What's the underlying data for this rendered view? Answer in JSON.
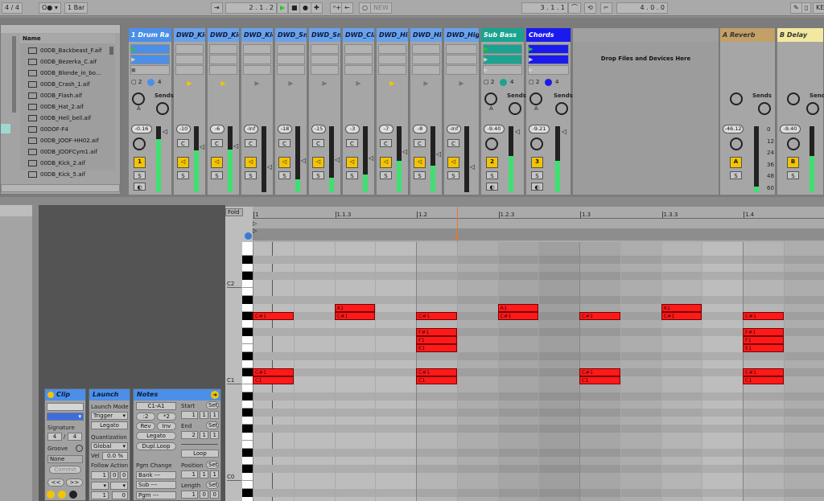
{
  "transport": {
    "signature": "4 / 4",
    "quant": "1 Bar",
    "position": "2 .  1 .  2",
    "new_label": "NEW",
    "loop_start": "3 .  1 .  1",
    "loop_length": "4 .  0 .  0",
    "key_label": "KE"
  },
  "browser": {
    "name_header": "Name",
    "files": [
      "00DB_Backbeast_F.aif",
      "00DB_Bezerka_C.aif",
      "00DB_Blonde_in_bo...",
      "00DB_Crash_1.aif",
      "00DB_Flash.aif",
      "00DB_Hat_2.aif",
      "00DB_Hell_bell.aif",
      "00DOF-F4",
      "00DB_JOOF-HH02.aif",
      "00DB_JOOFCym1.aif",
      "00DB_Kick_2.aif",
      "00DB_Kick_5.aif"
    ]
  },
  "tracks": [
    {
      "name": "1 Drum Ra",
      "color": "#4b8fe8",
      "volume": "-0.16",
      "number": "1",
      "meter": 0.8,
      "type": "group"
    },
    {
      "name": "DWD_Kic",
      "color": "#6aa2ea",
      "volume": "-10",
      "meter": 0.63,
      "type": "chain",
      "playing": true
    },
    {
      "name": "DWD_Kic",
      "color": "#6aa2ea",
      "volume": "-6",
      "meter": 0.65,
      "type": "chain",
      "playing": true
    },
    {
      "name": "DWD_Kic",
      "color": "#6aa2ea",
      "volume": "-Inf",
      "meter": 0,
      "type": "chain",
      "playing": false
    },
    {
      "name": "DWD_Sna",
      "color": "#6aa2ea",
      "volume": "-18",
      "meter": 0.2,
      "type": "chain",
      "playing": false
    },
    {
      "name": "DWD_Sna",
      "color": "#6aa2ea",
      "volume": "-15",
      "meter": 0.22,
      "type": "chain",
      "playing": false
    },
    {
      "name": "DWD_Cla",
      "color": "#6aa2ea",
      "volume": "-3",
      "meter": 0.27,
      "type": "chain",
      "playing": false
    },
    {
      "name": "DWD_Hig",
      "color": "#6aa2ea",
      "volume": "-7",
      "meter": 0.47,
      "type": "chain",
      "playing": true
    },
    {
      "name": "DWD_Hig",
      "color": "#6aa2ea",
      "volume": "-8",
      "meter": 0.4,
      "type": "chain",
      "playing": false
    },
    {
      "name": "DWD_Hig",
      "color": "#6aa2ea",
      "volume": "-Inf",
      "meter": 0,
      "type": "chain",
      "playing": false
    },
    {
      "name": "Sub Bass",
      "color": "#1aa38f",
      "volume": "-9.40",
      "number": "2",
      "meter": 0.55,
      "type": "group"
    },
    {
      "name": "Chords",
      "color": "#1a1aee",
      "volume": "-9.21",
      "number": "3",
      "meter": 0.47,
      "type": "group"
    }
  ],
  "drop_text": "Drop Files and Devices Here",
  "returns": [
    {
      "name": "A Reverb",
      "color": "#c2a068",
      "volume": "-46.12",
      "letter": "A",
      "meter": 0.08
    },
    {
      "name": "B Delay",
      "color": "#f2e8a0",
      "volume": "-9.40",
      "letter": "B",
      "meter": 0.55
    }
  ],
  "sends_label": "Sends",
  "send_a": "A",
  "send_b": "B",
  "solo": "S",
  "cue": "C",
  "meter_scale": [
    "0",
    "12",
    "24",
    "36",
    "48",
    "60"
  ],
  "clip": {
    "title": "Clip",
    "signature_label": "Signature",
    "sig_num": "4",
    "sig_den": "4",
    "groove_label": "Groove",
    "groove": "None",
    "commit": "Commit",
    "prev": "<<",
    "next": ">>"
  },
  "launch": {
    "title": "Launch",
    "mode_label": "Launch Mode",
    "mode": "Trigger",
    "legato": "Legato",
    "quant_label": "Quantization",
    "quant": "Global",
    "vel_label": "Vel",
    "vel": "0.0 %",
    "follow_label": "Follow Action",
    "f1": "1",
    "f2": "0",
    "f3": "0",
    "f4": "1",
    "f5": "0"
  },
  "notes": {
    "title": "Notes",
    "range": "C1-A1",
    "div": ":2",
    "mul": "*2",
    "rev": "Rev",
    "inv": "Inv",
    "legato": "Legato",
    "dupl": "Dupl.Loop",
    "pgm_label": "Pgm Change",
    "bank": "Bank ---",
    "sub": "Sub ---",
    "pgm": "Pgm ---",
    "start_label": "Start",
    "end_label": "End",
    "set": "Set",
    "start": [
      "1",
      "1",
      "1"
    ],
    "end": [
      "2",
      "1",
      "1"
    ],
    "loop": "Loop",
    "position_label": "Position",
    "position": [
      "1",
      "1",
      "1"
    ],
    "length_label": "Length",
    "length": [
      "1",
      "0",
      "0"
    ]
  },
  "roll": {
    "fold": "Fold",
    "ruler": [
      "1",
      "1.1.3",
      "1.2",
      "1.2.3",
      "1.3",
      "1.3.3",
      "1.4"
    ],
    "key_labels": [
      "C2",
      "C1",
      "C0"
    ],
    "notes": [
      {
        "label": "A1",
        "row": 9,
        "start16": 2
      },
      {
        "label": "A1",
        "row": 9,
        "start16": 6
      },
      {
        "label": "A1",
        "row": 9,
        "start16": 10
      },
      {
        "label": "C#1",
        "row": 8,
        "start16": 0
      },
      {
        "label": "C#1",
        "row": 8,
        "start16": 2
      },
      {
        "label": "C#1",
        "row": 8,
        "start16": 4
      },
      {
        "label": "C#1",
        "row": 8,
        "start16": 6
      },
      {
        "label": "C#1",
        "row": 8,
        "start16": 8
      },
      {
        "label": "C#1",
        "row": 8,
        "start16": 10
      },
      {
        "label": "C#1",
        "row": 8,
        "start16": 12
      },
      {
        "label": "F#1",
        "row": 6,
        "start16": 4
      },
      {
        "label": "F1",
        "row": 5,
        "start16": 4
      },
      {
        "label": "E1",
        "row": 4,
        "start16": 4
      },
      {
        "label": "F#1",
        "row": 6,
        "start16": 12
      },
      {
        "label": "F1",
        "row": 5,
        "start16": 12
      },
      {
        "label": "E1",
        "row": 4,
        "start16": 12
      },
      {
        "label": "C#1",
        "row": 1,
        "start16": 0
      },
      {
        "label": "C1",
        "row": 0,
        "start16": 0
      },
      {
        "label": "C#1",
        "row": 1,
        "start16": 4
      },
      {
        "label": "C1",
        "row": 0,
        "start16": 4
      },
      {
        "label": "C#1",
        "row": 1,
        "start16": 8
      },
      {
        "label": "C1",
        "row": 0,
        "start16": 8
      },
      {
        "label": "C#1",
        "row": 1,
        "start16": 12
      },
      {
        "label": "C1",
        "row": 0,
        "start16": 12
      }
    ],
    "note_length16": 1,
    "note_color": "#ff1a1a"
  }
}
